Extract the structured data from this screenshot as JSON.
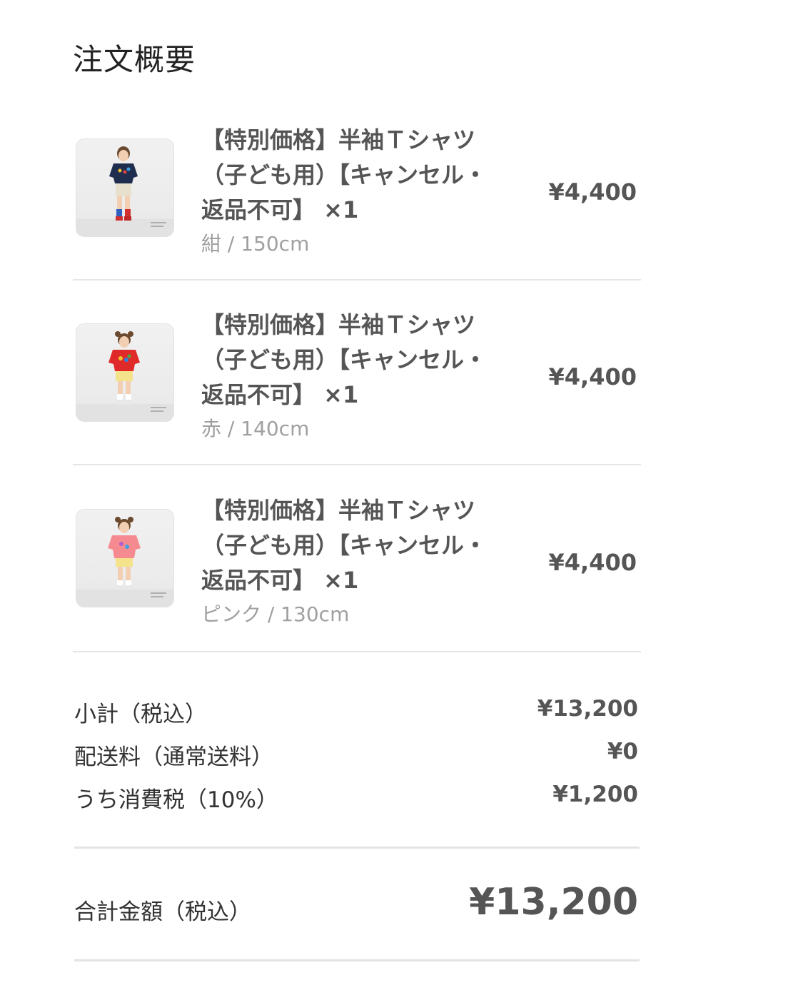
{
  "order_summary": {
    "title": "注文概要",
    "items": [
      {
        "name_line1": "【特別価格】半袖Ｔシャツ",
        "name_line2": "（子ども用）【キャンセル・",
        "name_line3": "返品不可】 ×1",
        "variant": "紺 / 150cm",
        "price": "¥4,400",
        "image_icon": "child-tshirt-photo-navy"
      },
      {
        "name_line1": "【特別価格】半袖Ｔシャツ",
        "name_line2": "（子ども用）【キャンセル・",
        "name_line3": "返品不可】 ×1",
        "variant": "赤 / 140cm",
        "price": "¥4,400",
        "image_icon": "child-tshirt-photo-red"
      },
      {
        "name_line1": "【特別価格】半袖Ｔシャツ",
        "name_line2": "（子ども用）【キャンセル・",
        "name_line3": "返品不可】 ×1",
        "variant": "ピンク / 130cm",
        "price": "¥4,400",
        "image_icon": "child-tshirt-photo-pink"
      }
    ],
    "subtotal": {
      "label": "小計（税込）",
      "value": "¥13,200"
    },
    "shipping": {
      "label": "配送料（通常送料）",
      "value": "¥0"
    },
    "tax": {
      "label": "うち消費税（10%）",
      "value": "¥1,200"
    },
    "total": {
      "label": "合計金額（税込）",
      "value": "¥13,200"
    }
  },
  "colors": {
    "shirt_navy": "#1f2d4e",
    "shirt_red": "#e02a2a",
    "shirt_pink": "#f58a90",
    "shorts_beige": "#e8e0cc",
    "shorts_yellow": "#f4e38a",
    "divider": "#e6e6e6",
    "variant_text": "#a0a0a0"
  }
}
